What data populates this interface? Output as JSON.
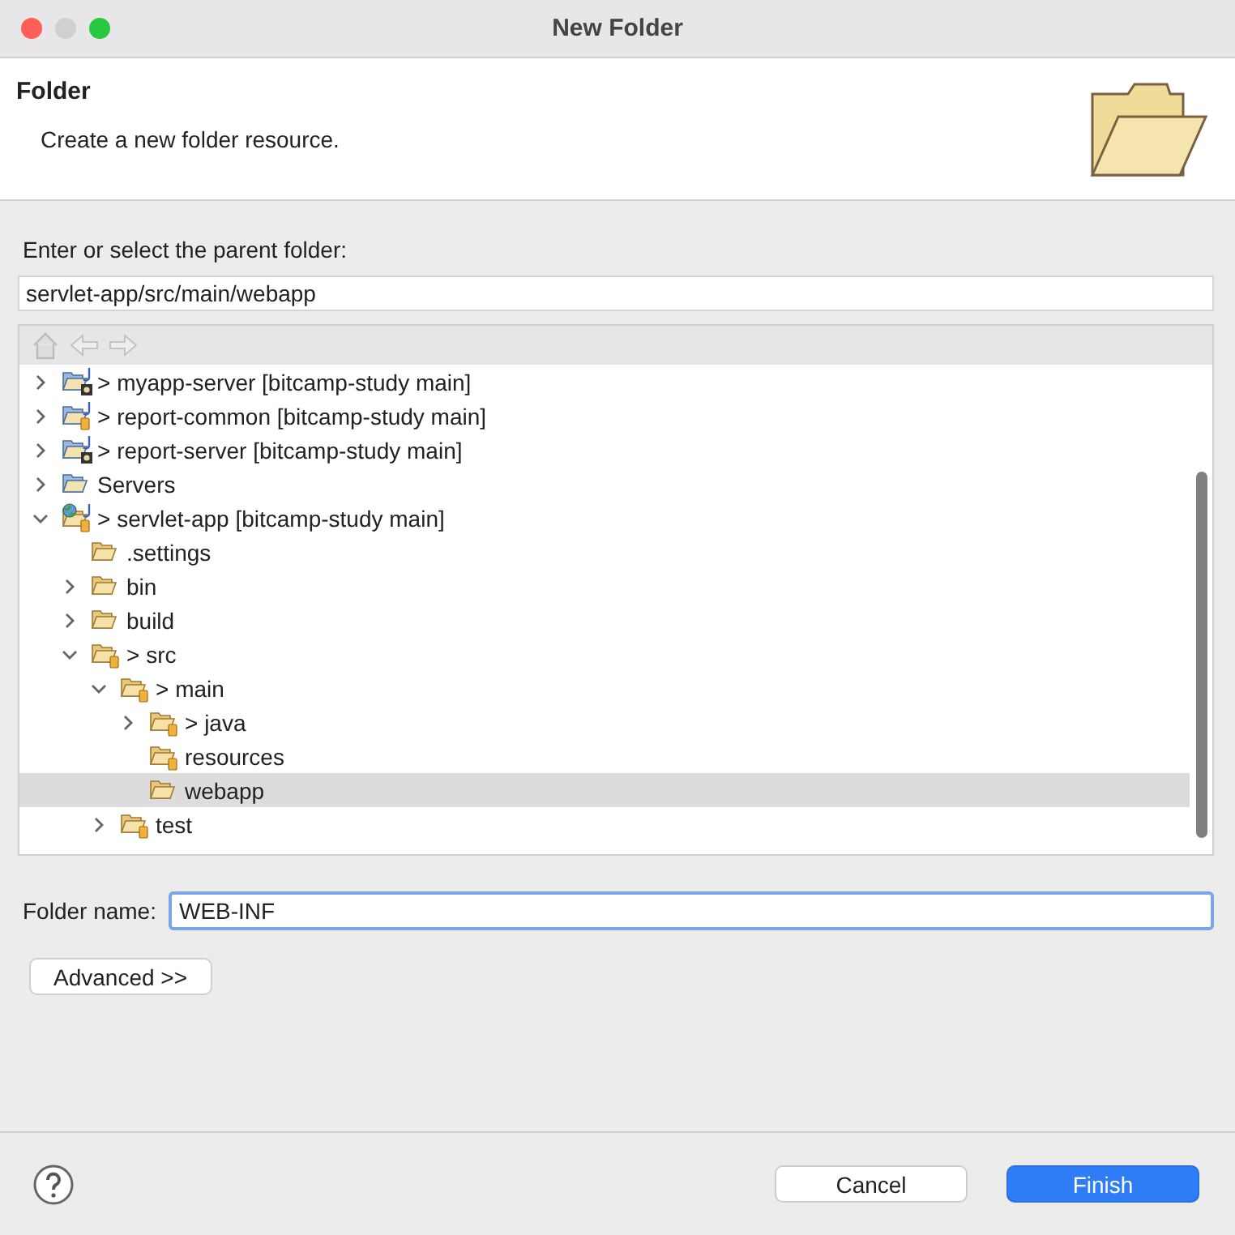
{
  "window": {
    "title": "New Folder"
  },
  "header": {
    "title": "Folder",
    "description": "Create a new folder resource."
  },
  "parent_label": "Enter or select the parent folder:",
  "parent_field": {
    "value": "servlet-app/src/main/webapp"
  },
  "tree": [
    {
      "label": "> myapp-server [bitcamp-study main]",
      "kind": "server-project",
      "expanded": false,
      "selected": false
    },
    {
      "label": "> report-common [bitcamp-study main]",
      "kind": "project",
      "expanded": false,
      "selected": false
    },
    {
      "label": "> report-server [bitcamp-study main]",
      "kind": "server-project",
      "expanded": false,
      "selected": false
    },
    {
      "label": "Servers",
      "kind": "servers",
      "expanded": false,
      "selected": false
    },
    {
      "label": "> servlet-app [bitcamp-study main]",
      "kind": "web-project",
      "expanded": true,
      "selected": false,
      "children": [
        {
          "label": ".settings",
          "kind": "folder",
          "selected": false
        },
        {
          "label": "bin",
          "kind": "folder",
          "expanded": false,
          "selected": false
        },
        {
          "label": "build",
          "kind": "folder",
          "expanded": false,
          "selected": false
        },
        {
          "label": "> src",
          "kind": "source",
          "expanded": true,
          "selected": false,
          "children": [
            {
              "label": "> main",
              "kind": "source",
              "expanded": true,
              "selected": false,
              "children": [
                {
                  "label": "> java",
                  "kind": "source",
                  "expanded": false,
                  "selected": false
                },
                {
                  "label": "resources",
                  "kind": "source",
                  "selected": false
                },
                {
                  "label": "webapp",
                  "kind": "folder",
                  "selected": true
                }
              ]
            },
            {
              "label": "test",
              "kind": "source",
              "expanded": false,
              "selected": false
            }
          ]
        }
      ]
    }
  ],
  "folder_name": {
    "label": "Folder name:",
    "value": "WEB-INF"
  },
  "advanced_button": "Advanced >>",
  "buttons": [
    {
      "label": "Cancel",
      "kind": "secondary"
    },
    {
      "label": "Finish",
      "kind": "primary"
    }
  ]
}
